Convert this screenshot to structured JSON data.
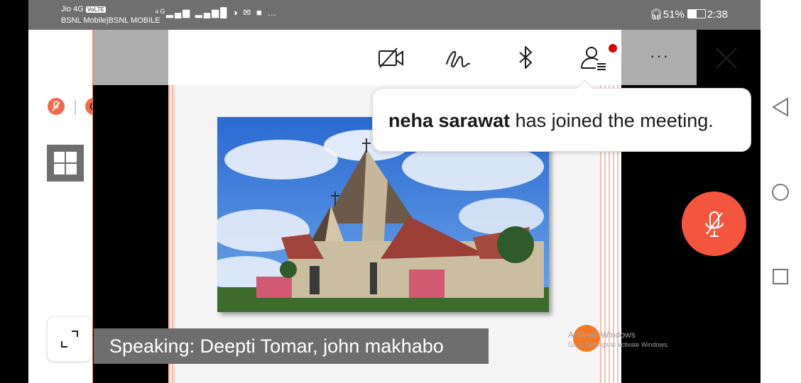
{
  "status_bar": {
    "carrier_line1": "Jio 4G",
    "volte_badge": "VoLTE",
    "carrier_line2": "BSNL Mobile|BSNL MOBILE",
    "battery": "51%",
    "time": "2:38"
  },
  "left_panel": {
    "mute_badge_icon": "mic-off-icon",
    "record_badge_icon": "record-icon",
    "layout_button_icon": "grid-layout-icon",
    "expand_button_icon": "expand-icon"
  },
  "toolbar": {
    "items": [
      {
        "name": "video-off",
        "icon": "video-off-icon"
      },
      {
        "name": "annotate",
        "icon": "pen-squiggle-icon"
      },
      {
        "name": "bluetooth",
        "icon": "bluetooth-icon"
      },
      {
        "name": "participants",
        "icon": "participants-icon",
        "has_notification": true
      },
      {
        "name": "more",
        "icon": "more-icon",
        "label": "···"
      },
      {
        "name": "close",
        "icon": "close-icon"
      }
    ]
  },
  "toast": {
    "name": "neha sarawat",
    "message": " has joined the meeting."
  },
  "speaking_banner": {
    "text": "Speaking: Deepti Tomar, john makhabo"
  },
  "watermark": {
    "line1": "Activate Windows",
    "line2": "Go to Settings to activate Windows."
  },
  "mic_button": {
    "icon": "mic-off-icon",
    "state": "muted"
  },
  "android_nav": {
    "back": "back-icon",
    "home": "home-icon",
    "recents": "recents-icon"
  },
  "colors": {
    "accent": "#f3553f",
    "status_bar": "#6f6f6f",
    "notification_dot": "#e00000",
    "banner": "#6e6e6e"
  }
}
